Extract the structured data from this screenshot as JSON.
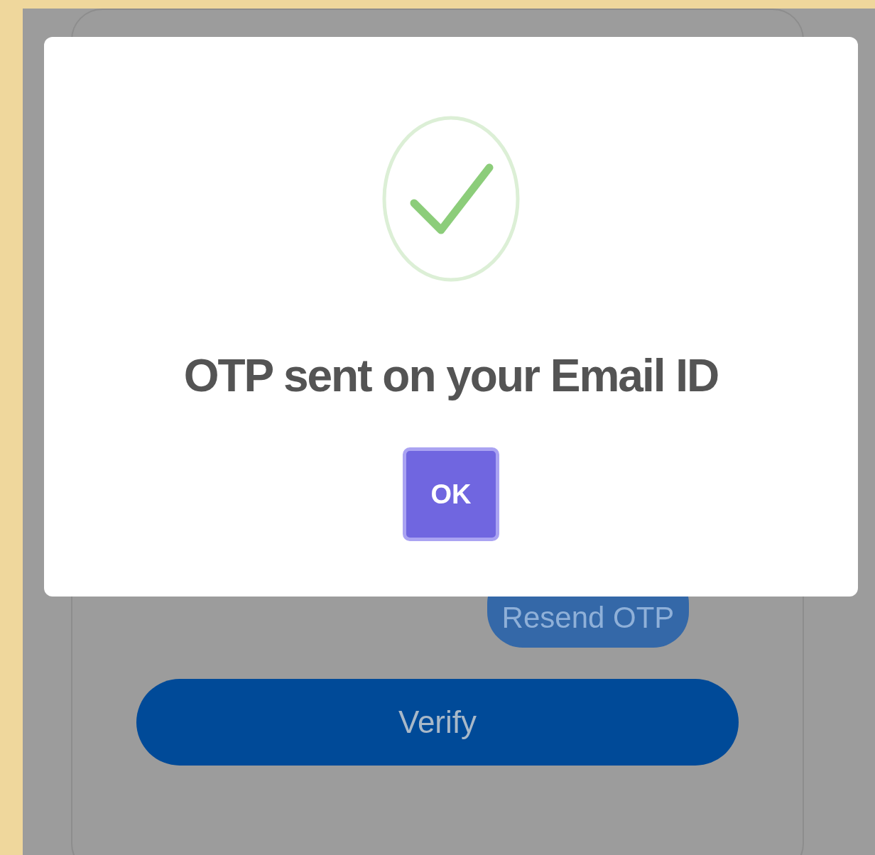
{
  "dialog": {
    "title": "OTP sent on your Email ID",
    "button": "OK"
  },
  "form": {
    "resend_button": "Resend OTP",
    "verify_button": "Verify"
  }
}
